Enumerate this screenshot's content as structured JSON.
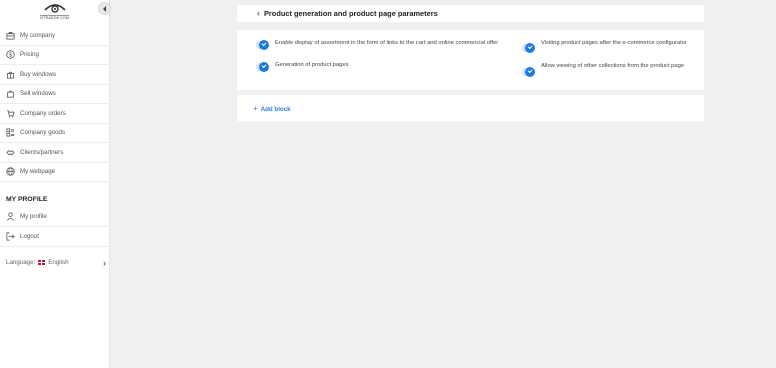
{
  "logo": {
    "text": "VITRASOK.COM"
  },
  "sidebar": {
    "items": [
      {
        "label": "My company",
        "icon": "briefcase-icon"
      },
      {
        "label": "Pricing",
        "icon": "dollar-icon"
      },
      {
        "label": "Buy windows",
        "icon": "cart-icon"
      },
      {
        "label": "Sell windows",
        "icon": "bag-icon"
      },
      {
        "label": "Company orders",
        "icon": "orders-icon"
      },
      {
        "label": "Company goods",
        "icon": "goods-icon"
      },
      {
        "label": "Clients/partners",
        "icon": "handshake-icon"
      },
      {
        "label": "My webpage",
        "icon": "globe-icon"
      }
    ],
    "profile_title": "MY PROFILE",
    "profile_items": [
      {
        "label": "My profile",
        "icon": "user-icon"
      },
      {
        "label": "Logout",
        "icon": "logout-icon"
      }
    ],
    "language_label": "Language:",
    "language_value": "English"
  },
  "header": {
    "title": "Product generation and product page parameters"
  },
  "params": [
    {
      "label": "Enable display of assortment in the form of links to the cart and online commercial offer",
      "checked": true
    },
    {
      "label": "Visiting product pages after the e-commerce configurator",
      "checked": true
    },
    {
      "label": "Generation of product pages",
      "checked": true
    },
    {
      "label": "Allow viewing of other collections from the product page",
      "checked": true
    }
  ],
  "add_block": {
    "label": "Add block"
  },
  "colors": {
    "accent": "#1f7bd8",
    "link": "#2a7de1",
    "background": "#f0f0f0"
  }
}
